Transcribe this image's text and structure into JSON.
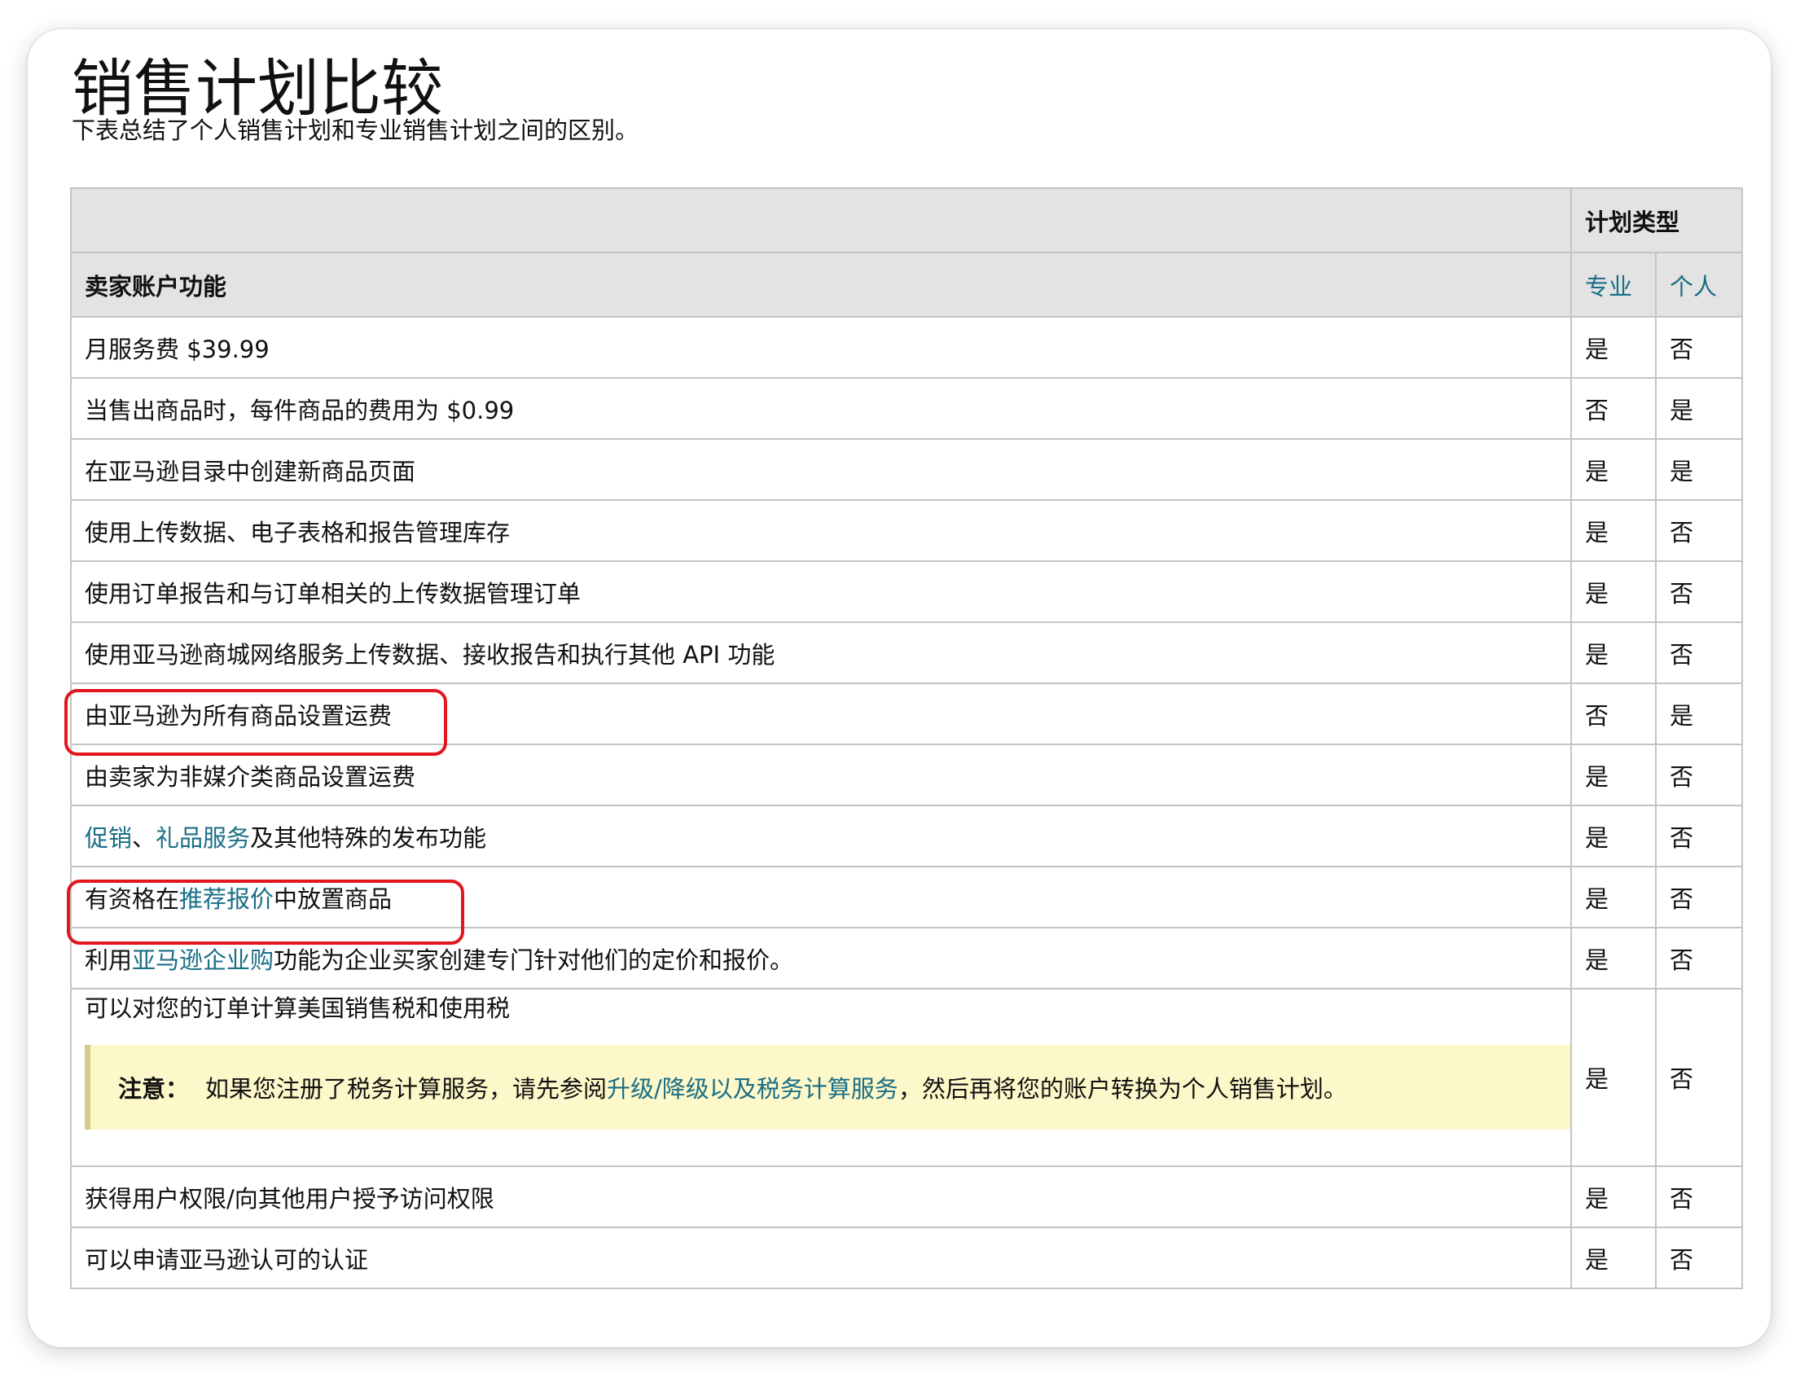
{
  "page": {
    "title": "销售计划比较",
    "subtitle": "下表总结了个人销售计划和专业销售计划之间的区别。"
  },
  "table": {
    "header": {
      "plan_type": "计划类型",
      "feature": "卖家账户功能",
      "pro": "专业",
      "individual": "个人"
    },
    "rows": [
      {
        "feature": "月服务费 $39.99",
        "pro": "是",
        "individual": "否"
      },
      {
        "feature": "当售出商品时，每件商品的费用为 $0.99",
        "pro": "否",
        "individual": "是"
      },
      {
        "feature": "在亚马逊目录中创建新商品页面",
        "pro": "是",
        "individual": "是"
      },
      {
        "feature": "使用上传数据、电子表格和报告管理库存",
        "pro": "是",
        "individual": "否"
      },
      {
        "feature": "使用订单报告和与订单相关的上传数据管理订单",
        "pro": "是",
        "individual": "否"
      },
      {
        "feature": "使用亚马逊商城网络服务上传数据、接收报告和执行其他 API 功能",
        "pro": "是",
        "individual": "否"
      },
      {
        "feature": "由亚马逊为所有商品设置运费",
        "pro": "否",
        "individual": "是"
      },
      {
        "feature": "由卖家为非媒介类商品设置运费",
        "pro": "是",
        "individual": "否"
      },
      {
        "feature_link1": "促销",
        "feature_sep": "、",
        "feature_link2": "礼品服务",
        "feature_tail": "及其他特殊的发布功能",
        "pro": "是",
        "individual": "否"
      },
      {
        "feature_head": "有资格在",
        "feature_link": "推荐报价",
        "feature_tail": "中放置商品",
        "pro": "是",
        "individual": "否"
      },
      {
        "feature_head": "利用",
        "feature_link": "亚马逊企业购",
        "feature_tail": "功能为企业买家创建专门针对他们的定价和报价。",
        "pro": "是",
        "individual": "否"
      },
      {
        "feature": "可以对您的订单计算美国销售税和使用税",
        "pro": "是",
        "individual": "否",
        "note": {
          "label": "注意：",
          "text_head": "如果您注册了税务计算服务，请先参阅",
          "link": "升级/降级以及税务计算服务",
          "text_tail": "，然后再将您的账户转换为个人销售计划。"
        }
      },
      {
        "feature": "获得用户权限/向其他用户授予访问权限",
        "pro": "是",
        "individual": "否"
      },
      {
        "feature": "可以申请亚马逊认可的认证",
        "pro": "是",
        "individual": "否"
      }
    ]
  },
  "colors": {
    "link": "#1a6e86",
    "header_bg": "#e3e3e3",
    "border": "#c4c4c4",
    "note_bg": "#fdf8c9",
    "highlight": "#e3161e"
  }
}
